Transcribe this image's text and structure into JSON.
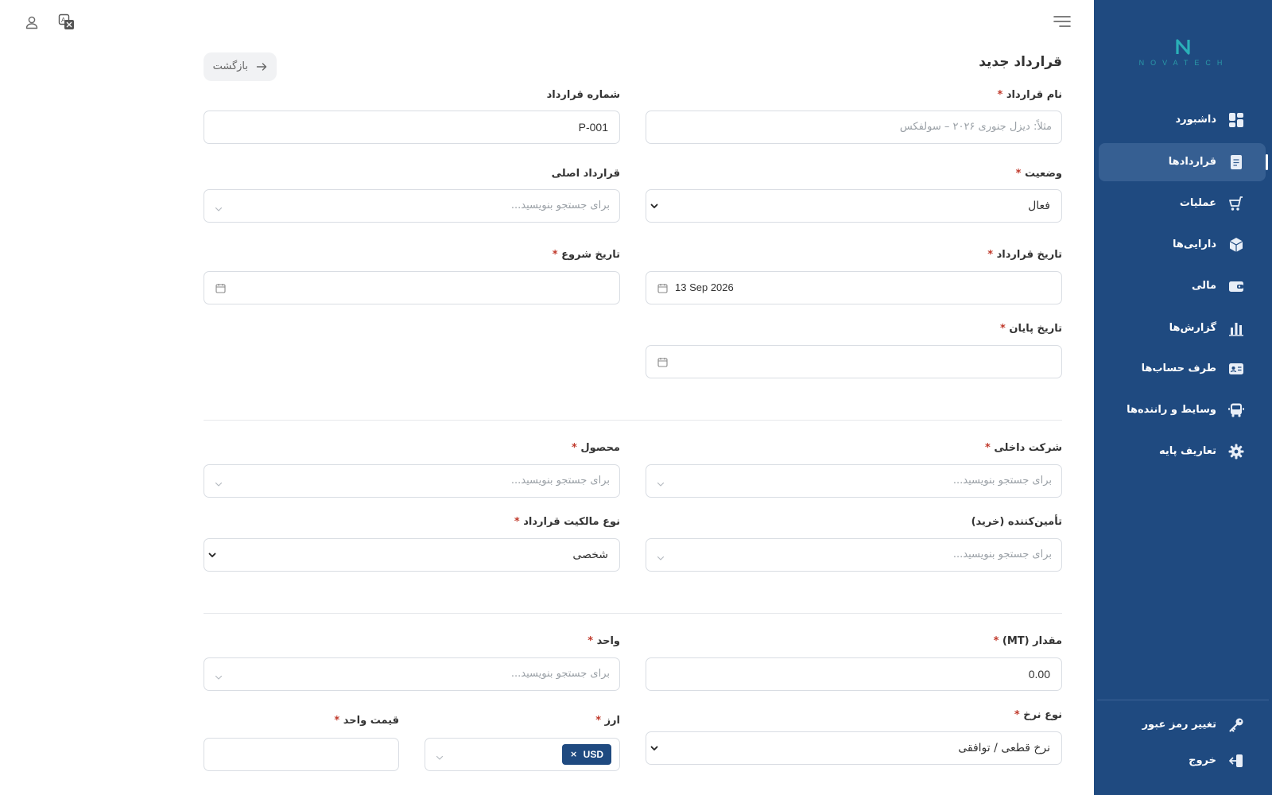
{
  "app": {
    "logo_text": "NOVATECH"
  },
  "sidebar": {
    "items": [
      {
        "label": "داشبورد",
        "icon": "dashboard-icon"
      },
      {
        "label": "قراردادها",
        "icon": "document-icon",
        "active": true
      },
      {
        "label": "عملیات",
        "icon": "cart-icon"
      },
      {
        "label": "دارایی‌ها",
        "icon": "box-icon"
      },
      {
        "label": "مالی",
        "icon": "wallet-icon"
      },
      {
        "label": "گزارش‌ها",
        "icon": "bar-chart-icon"
      },
      {
        "label": "طرف حساب‌ها",
        "icon": "id-card-icon"
      },
      {
        "label": "وسایط و راننده‌ها",
        "icon": "bus-icon"
      },
      {
        "label": "تعاریف پایه",
        "icon": "gear-icon"
      }
    ],
    "change_password": "تغییر رمز عبور",
    "logout": "خروج"
  },
  "header": {
    "page_title": "قرارداد جدید",
    "back_label": "بازگشت"
  },
  "form": {
    "contract_name": {
      "label": "نام قرارداد",
      "placeholder": "مثلاً: دیزل جنوری ۲۰۲۶ – سولفکس"
    },
    "contract_number": {
      "label": "شماره قرارداد",
      "value": "P-001"
    },
    "status": {
      "label": "وضعیت",
      "value": "فعال"
    },
    "parent_contract": {
      "label": "قرارداد اصلی",
      "placeholder": "برای جستجو بنویسید..."
    },
    "contract_date": {
      "label": "تاریخ قرارداد",
      "value": "13 Sep 2026"
    },
    "start_date": {
      "label": "تاریخ شروع",
      "value": ""
    },
    "end_date": {
      "label": "تاریخ پایان",
      "value": ""
    },
    "internal_company": {
      "label": "شرکت داخلی",
      "placeholder": "برای جستجو بنویسید..."
    },
    "product": {
      "label": "محصول",
      "placeholder": "برای جستجو بنویسید..."
    },
    "supplier": {
      "label": "تأمین‌کننده (خرید)",
      "placeholder": "برای جستجو بنویسید..."
    },
    "ownership_type": {
      "label": "نوع مالکیت قرارداد",
      "value": "شخصی"
    },
    "quantity": {
      "label": "مقدار (MT)",
      "value": "0.00"
    },
    "unit": {
      "label": "واحد",
      "placeholder": "برای جستجو بنویسید..."
    },
    "rate_type": {
      "label": "نوع نرخ",
      "value": "نرخ قطعی / توافقی"
    },
    "currency": {
      "label": "ارز",
      "tag": "USD",
      "remove": "×"
    },
    "unit_price": {
      "label": "قیمت واحد",
      "value": ""
    },
    "required_mark": "*"
  },
  "colors": {
    "sidebar_bg": "#1f4a80",
    "sidebar_active": "#365f92",
    "required": "#c0392b",
    "tag_bg": "#1f4a80"
  }
}
